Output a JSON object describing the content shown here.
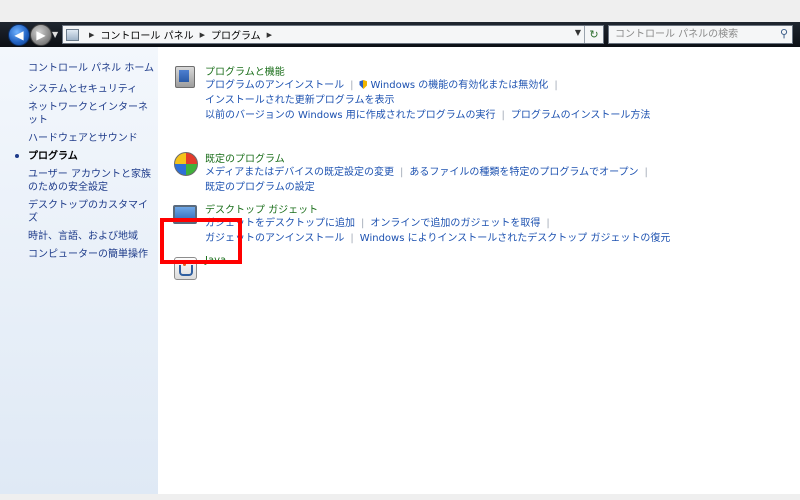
{
  "address": {
    "crumbs": [
      "コントロール パネル",
      "プログラム"
    ]
  },
  "search": {
    "placeholder": "コントロール パネルの検索"
  },
  "sidebar": {
    "home": "コントロール パネル ホーム",
    "items": [
      {
        "label": "システムとセキュリティ"
      },
      {
        "label": "ネットワークとインターネット"
      },
      {
        "label": "ハードウェアとサウンド"
      },
      {
        "label": "プログラム",
        "current": true
      },
      {
        "label": "ユーザー アカウントと家族のための安全設定"
      },
      {
        "label": "デスクトップのカスタマイズ"
      },
      {
        "label": "時計、言語、および地域"
      },
      {
        "label": "コンピューターの簡単操作"
      }
    ]
  },
  "categories": [
    {
      "title": "プログラムと機能",
      "icon": "programs-icon",
      "links": [
        [
          "プログラムのアンインストール",
          "Windows の機能の有効化または無効化"
        ],
        [
          "インストールされた更新プログラムを表示"
        ],
        [
          "以前のバージョンの Windows 用に作成されたプログラムの実行",
          "プログラムのインストール方法"
        ]
      ]
    },
    {
      "title": "既定のプログラム",
      "icon": "default-programs-icon",
      "links": [
        [
          "メディアまたはデバイスの既定設定の変更",
          "あるファイルの種類を特定のプログラムでオープン"
        ],
        [
          "既定のプログラムの設定"
        ]
      ]
    },
    {
      "title": "デスクトップ ガジェット",
      "icon": "desktop-gadgets-icon",
      "links": [
        [
          "ガジェットをデスクトップに追加",
          "オンラインで追加のガジェットを取得"
        ],
        [
          "ガジェットのアンインストール",
          "Windows によりインストールされたデスクトップ ガジェットの復元"
        ]
      ]
    },
    {
      "title": "Java",
      "icon": "java-icon",
      "links": []
    }
  ],
  "colors": {
    "highlight": "#ff0000",
    "link": "#1c51b0",
    "category_title": "#1a6e1a"
  }
}
